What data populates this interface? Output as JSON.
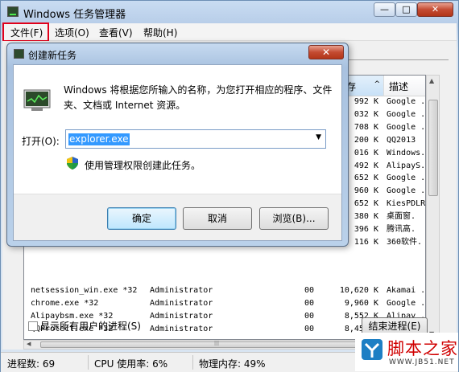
{
  "window": {
    "title": "Windows 任务管理器",
    "min": "—",
    "max": "□",
    "close": "✕"
  },
  "menu": [
    {
      "label": "文件(F)"
    },
    {
      "label": "选项(O)"
    },
    {
      "label": "查看(V)"
    },
    {
      "label": "帮助(H)"
    }
  ],
  "process_list": {
    "headers": {
      "memory": "存",
      "memory_sort": "^",
      "description": "描述"
    },
    "top_rows": [
      {
        "memory": "992 K",
        "desc": "Google ."
      },
      {
        "memory": "032 K",
        "desc": "Google ."
      },
      {
        "memory": "708 K",
        "desc": "Google ."
      },
      {
        "memory": "200 K",
        "desc": "QQ2013"
      },
      {
        "memory": "016 K",
        "desc": "Windows."
      },
      {
        "memory": "492 K",
        "desc": "AlipayS."
      },
      {
        "memory": "652 K",
        "desc": "Google ."
      },
      {
        "memory": "960 K",
        "desc": "Google ."
      },
      {
        "memory": "652 K",
        "desc": "KiesPDLR"
      },
      {
        "memory": "380 K",
        "desc": "桌面窗."
      },
      {
        "memory": "396 K",
        "desc": "腾讯高."
      },
      {
        "memory": "116 K",
        "desc": "360软件."
      }
    ],
    "bottom_rows": [
      {
        "name": "netsession_win.exe *32",
        "user": "Administrator",
        "cpu": "00",
        "memory": "10,620 K",
        "desc": "Akamai ."
      },
      {
        "name": "chrome.exe *32",
        "user": "Administrator",
        "cpu": "00",
        "memory": "9,960 K",
        "desc": "Google ."
      },
      {
        "name": "Alipaybsm.exe *32",
        "user": "Administrator",
        "cpu": "00",
        "memory": "8,552 K",
        "desc": "Alipay ."
      },
      {
        "name": "QQProtect.exe *32",
        "user": "Administrator",
        "cpu": "00",
        "memory": "8,456 K",
        "desc": "QQProtec"
      }
    ]
  },
  "show_all_users": "显示所有用户的进程(S)",
  "end_process": "结束进程(E)",
  "status": {
    "processes": "进程数: 69",
    "cpu": "CPU 使用率: 6%",
    "memory": "物理内存: 49%"
  },
  "watermark": {
    "brand": "脚本之家",
    "url": "WWW.JB51.NET"
  },
  "dialog": {
    "title": "创建新任务",
    "close": "✕",
    "description": "Windows 将根据您所输入的名称，为您打开相应的程序、文件夹、文档或 Internet 资源。",
    "open_label": "打开(O):",
    "open_value": "explorer.exe",
    "admin_text": "使用管理权限创建此任务。",
    "ok": "确定",
    "cancel": "取消",
    "browse": "浏览(B)..."
  },
  "colors": {
    "highlight_box": "#e1001a",
    "selection": "#3399ff",
    "watermark_red": "#d00000"
  }
}
